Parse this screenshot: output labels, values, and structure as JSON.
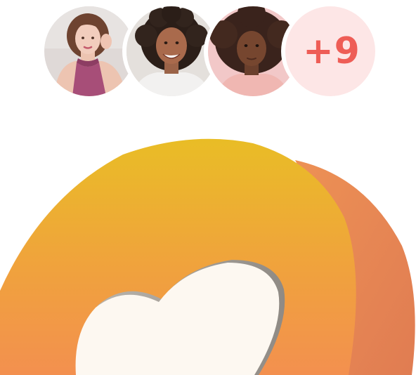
{
  "avatars": [
    {
      "name": "avatar-woman-velvet-top",
      "portrait": "person-portrait-icon"
    },
    {
      "name": "avatar-woman-curly-smiling",
      "portrait": "person-portrait-icon"
    },
    {
      "name": "avatar-woman-afro-pink",
      "portrait": "person-portrait-icon"
    }
  ],
  "avatar_overflow": {
    "label": "+9",
    "text_color": "#ee5d56",
    "background": "#fde6e6"
  },
  "logo": {
    "icon": "heart-blob-logo-icon",
    "colors": {
      "top": "#e9bd26",
      "bottom": "#f1924b",
      "side": "#ec8d54",
      "heart": "#fdf8f1"
    }
  }
}
